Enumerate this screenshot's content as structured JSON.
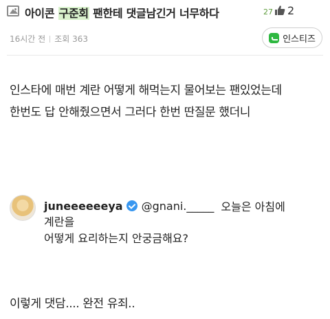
{
  "post": {
    "title_prefix": "아이콘 ",
    "title_highlight": "구준회",
    "title_suffix": " 팬한테 댓글남긴거 너무하다",
    "comment_count": "27",
    "like_count": "2",
    "time_ago": "16시간 전",
    "views": "조회 363",
    "source_label": "인스티즈"
  },
  "body": {
    "line1": "인스타에 매번 계란 어떻게 해먹는지 물어보는 팬있었는데",
    "line2": "한번도 답 안해줬으면서 그러다 한번 딴질문 했더니"
  },
  "quote": {
    "username": "juneeeeeeya",
    "mention": "@gnani._____",
    "text_line1": "오늘은 아침에",
    "text_line2": "계란을",
    "text_line3": "어떻게 요리하는지 안궁금해요?"
  },
  "footer": {
    "text": "이렇게 댓담.... 완전 유죄.."
  },
  "colors": {
    "highlight": "#d9f2cc",
    "comment_count": "#5c9b3b",
    "source_brand": "#2eb840",
    "verified": "#3897f0"
  },
  "icons": [
    "image-icon",
    "thumbs-up-icon",
    "instiz-logo-icon",
    "verified-badge-icon"
  ]
}
